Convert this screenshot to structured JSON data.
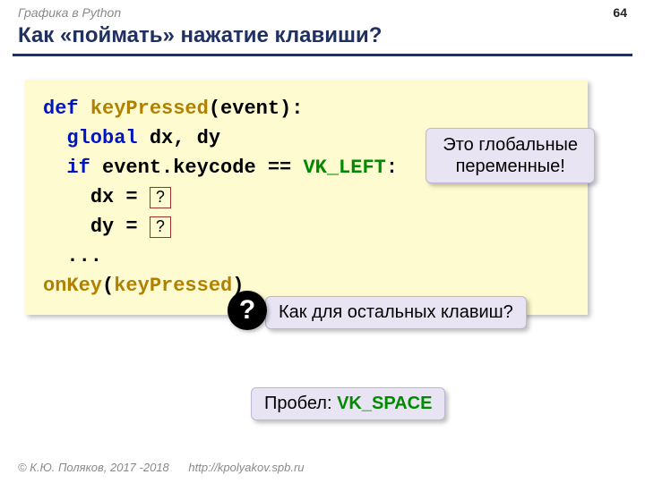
{
  "header": {
    "course": "Графика в Python",
    "page_number": "64"
  },
  "title": "Как «поймать» нажатие клавиши?",
  "code": {
    "def_kw": "def",
    "fn_name": "keyPressed",
    "param": "(event):",
    "global_kw": "global",
    "global_vars": "dx, dy",
    "if_kw": "if",
    "if_expr_left": "event.keycode ==",
    "if_const": "VK_LEFT",
    "if_colon": ":",
    "dx_assign": "dx = ",
    "q1": "?",
    "dy_assign": "dy = ",
    "q2": "?",
    "dots": "...",
    "onkey_fn": "onKey",
    "onkey_arg_open": "(",
    "onkey_arg": "keyPressed",
    "onkey_arg_close": ")"
  },
  "callouts": {
    "global_note_l1": "Это глобальные",
    "global_note_l2": "переменные!",
    "other_keys": "Как для остальных клавиш?",
    "space_prefix": "Пробел: ",
    "space_const": "VK_SPACE",
    "qmark": "?"
  },
  "footer": {
    "copyright": "© К.Ю. Поляков, 2017 -2018",
    "url": "http://kpolyakov.spb.ru"
  }
}
